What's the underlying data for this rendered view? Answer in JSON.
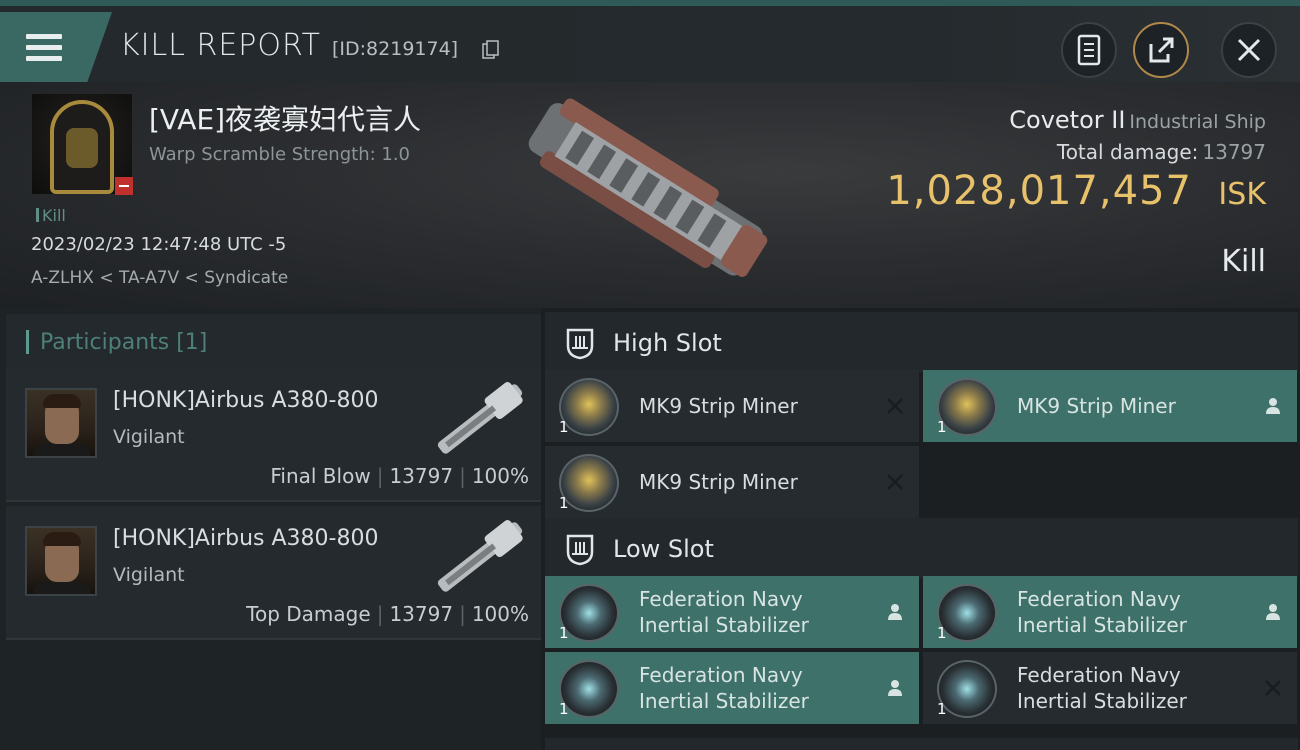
{
  "header": {
    "title": "KILL REPORT",
    "report_id": "[ID:8219174]",
    "menu_icon": "hamburger-menu-icon",
    "buttons": [
      "report-icon",
      "share-icon",
      "close-icon"
    ]
  },
  "victim": {
    "name": "[VAE]夜袭寡妇代言人",
    "warp_scramble": "Warp Scramble Strength: 1.0",
    "tag": "Kill",
    "time": "2023/02/23 12:47:48 UTC -5",
    "location": "A-ZLHX < TA-A7V < Syndicate"
  },
  "ship": {
    "name": "Covetor II",
    "class": "Industrial Ship",
    "total_damage_label": "Total damage:",
    "total_damage": "13797",
    "isk_value": "1,028,017,457",
    "isk_unit": "ISK",
    "result": "Kill"
  },
  "participants": {
    "title": "Participants [1]",
    "items": [
      {
        "name": "[HONK]Airbus A380-800",
        "ship": "Vigilant",
        "role": "Final Blow",
        "damage": "13797",
        "percent": "100%"
      },
      {
        "name": "[HONK]Airbus A380-800",
        "ship": "Vigilant",
        "role": "Top Damage",
        "damage": "13797",
        "percent": "100%"
      }
    ]
  },
  "slots": {
    "high": {
      "title": "High Slot",
      "items": [
        {
          "name": "MK9 Strip Miner",
          "qty": "1",
          "status": "destroyed"
        },
        {
          "name": "MK9 Strip Miner",
          "qty": "1",
          "status": "dropped"
        },
        {
          "name": "MK9 Strip Miner",
          "qty": "1",
          "status": "destroyed"
        }
      ]
    },
    "low": {
      "title": "Low Slot",
      "items": [
        {
          "name_line1": "Federation Navy",
          "name_line2": "Inertial Stabilizer",
          "qty": "1",
          "status": "dropped"
        },
        {
          "name_line1": "Federation Navy",
          "name_line2": "Inertial Stabilizer",
          "qty": "1",
          "status": "dropped"
        },
        {
          "name_line1": "Federation Navy",
          "name_line2": "Inertial Stabilizer",
          "qty": "1",
          "status": "dropped"
        },
        {
          "name_line1": "Federation Navy",
          "name_line2": "Inertial Stabilizer",
          "qty": "1",
          "status": "destroyed"
        }
      ]
    }
  },
  "colors": {
    "accent": "#3f716b",
    "isk": "#e8c16b",
    "loss_badge": "#c0302c"
  }
}
